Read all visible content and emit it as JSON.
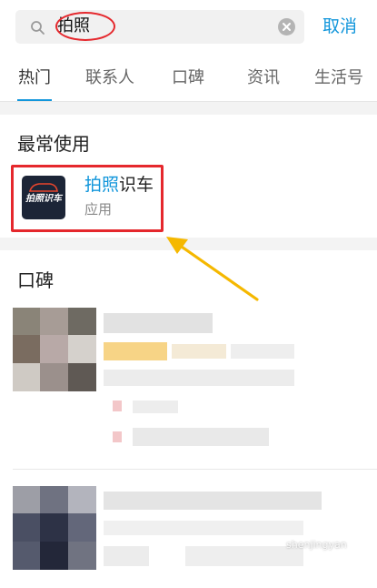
{
  "search": {
    "query": "拍照",
    "cancel_label": "取消"
  },
  "tabs": [
    {
      "label": "热门",
      "active": true
    },
    {
      "label": "联系人",
      "active": false
    },
    {
      "label": "口碑",
      "active": false
    },
    {
      "label": "资讯",
      "active": false
    },
    {
      "label": "生活号",
      "active": false
    }
  ],
  "most_used": {
    "title": "最常使用",
    "app": {
      "name_highlight": "拍照",
      "name_rest": "识车",
      "type": "应用",
      "icon_text": "拍照识车",
      "icon_name": "car-recognition-app-icon"
    }
  },
  "koubei": {
    "title": "口碑"
  },
  "colors": {
    "accent": "#1296db",
    "annotation_red": "#e5282d",
    "arrow_yellow": "#f5b800"
  }
}
